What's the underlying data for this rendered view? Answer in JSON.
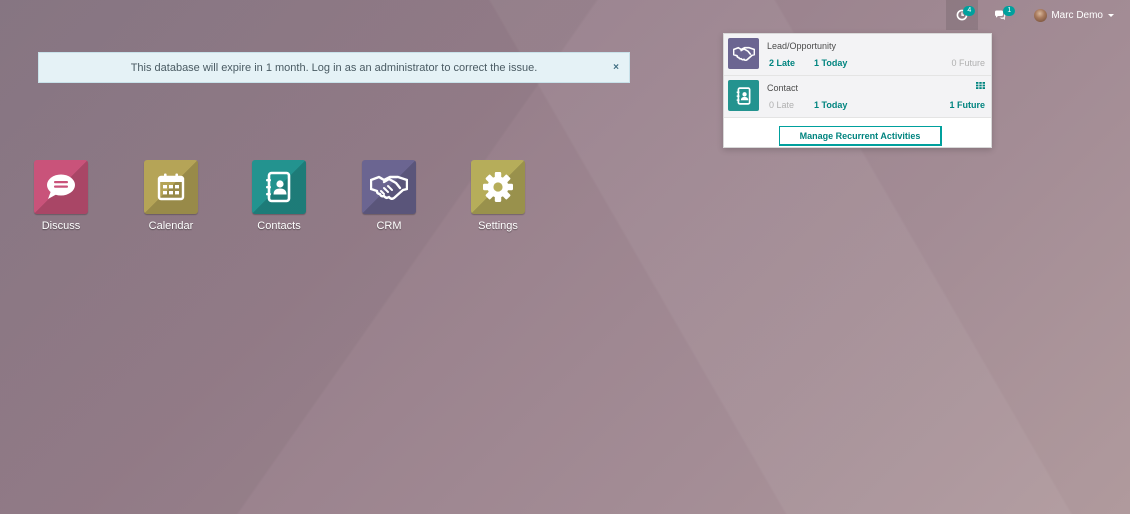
{
  "topbar": {
    "activity_badge": "4",
    "messages_badge": "1",
    "user_name": "Marc Demo"
  },
  "banner": {
    "text": "This database will expire in 1 month. Log in as an administrator to correct the issue.",
    "close": "×"
  },
  "apps": [
    {
      "label": "Discuss",
      "color": "#c9537a",
      "icon": "chat-bubble-icon"
    },
    {
      "label": "Calendar",
      "color": "#b5a457",
      "icon": "calendar-icon"
    },
    {
      "label": "Contacts",
      "color": "#23938f",
      "icon": "address-book-icon"
    },
    {
      "label": "CRM",
      "color": "#6b6591",
      "icon": "handshake-icon"
    },
    {
      "label": "Settings",
      "color": "#b6ad5a",
      "icon": "gear-icon"
    }
  ],
  "activities": {
    "items": [
      {
        "title": "Lead/Opportunity",
        "late": "2 Late",
        "today": "1 Today",
        "future": "0 Future",
        "color": "#6b6591",
        "icon": "handshake-icon"
      },
      {
        "title": "Contact",
        "late": "0 Late",
        "today": "1 Today",
        "future": "1 Future",
        "color": "#23938f",
        "icon": "address-book-icon"
      }
    ],
    "manage_label": "Manage Recurrent Activities"
  },
  "colors": {
    "accent": "#00a09d",
    "accent_text": "#00847f"
  }
}
